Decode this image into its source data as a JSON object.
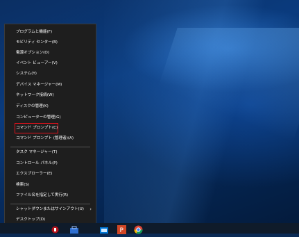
{
  "context_menu": {
    "items": [
      {
        "label": "プログラムと機能(F)"
      },
      {
        "label": "モビリティ センター(B)"
      },
      {
        "label": "電源オプション(O)"
      },
      {
        "label": "イベント ビューアー(V)"
      },
      {
        "label": "システム(Y)"
      },
      {
        "label": "デバイス マネージャー(M)"
      },
      {
        "label": "ネットワーク接続(W)"
      },
      {
        "label": "ディスクの管理(K)"
      },
      {
        "label": "コンピューターの管理(G)"
      },
      {
        "label": "コマンド プロンプト(C)"
      },
      {
        "label": "コマンド プロンプト (管理者)(A)"
      },
      {
        "label": "タスク マネージャー(T)"
      },
      {
        "label": "コントロール パネル(P)"
      },
      {
        "label": "エクスプローラー(E)"
      },
      {
        "label": "検索(S)"
      },
      {
        "label": "ファイル名を指定して実行(R)"
      },
      {
        "label": "シャットダウンまたはサインアウト(U)"
      },
      {
        "label": "デスクトップ(D)"
      }
    ],
    "highlighted_item": "コマンド プロンプト(C)",
    "highlight_color": "#e3121c"
  },
  "taskbar": {
    "icons": [
      "windows-logo-icon",
      "media-icon",
      "store-icon",
      "powerpoint-icon",
      "chrome-icon"
    ]
  },
  "colors": {
    "menu_bg": "#1e1e1e",
    "desktop_bg": "#0a2a55",
    "taskbar_bg": "#0f1b2a"
  }
}
